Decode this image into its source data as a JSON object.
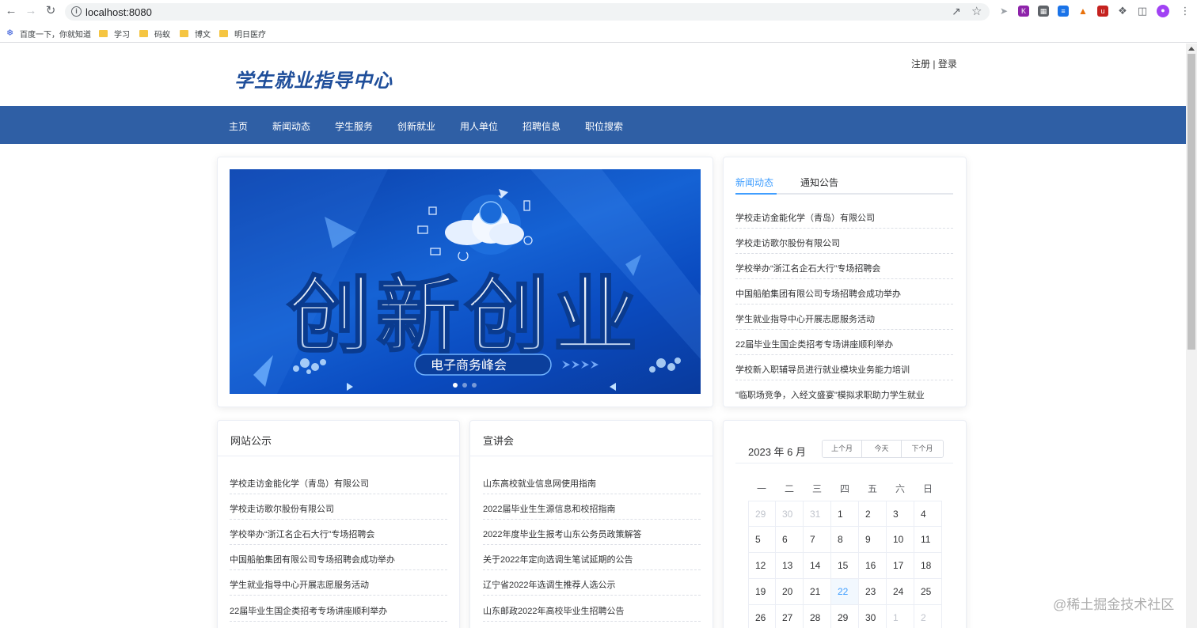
{
  "browser": {
    "url": "localhost:8080",
    "bookmarks": [
      "百度一下，你就知道",
      "学习",
      "码蚁",
      "博文",
      "明日医疗"
    ]
  },
  "header": {
    "logo_text": "学生就业指导中心",
    "register": "注册",
    "separator": "|",
    "login": "登录"
  },
  "nav": [
    "主页",
    "新闻动态",
    "学生服务",
    "创新就业",
    "用人单位",
    "招聘信息",
    "职位搜索"
  ],
  "banner": {
    "headline": "创新创业",
    "subtitle": "电子商务峰会",
    "active_slide": 0,
    "slide_count": 3
  },
  "news": {
    "tabs": [
      "新闻动态",
      "通知公告"
    ],
    "active_tab": 0,
    "items": [
      "学校走访金能化学（青岛）有限公司",
      "学校走访歌尔股份有限公司",
      "学校举办“浙江名企石大行”专场招聘会",
      "中国船舶集团有限公司专场招聘会成功举办",
      "学生就业指导中心开展志愿服务活动",
      "22届毕业生国企类招考专场讲座顺利举办",
      "学校新入职辅导员进行就业模块业务能力培训",
      "\"临职场竞争，入经文盛宴\"模拟求职助力学生就业"
    ]
  },
  "announcements": {
    "title": "网站公示",
    "items": [
      "学校走访金能化学（青岛）有限公司",
      "学校走访歌尔股份有限公司",
      "学校举办“浙江名企石大行”专场招聘会",
      "中国船舶集团有限公司专场招聘会成功举办",
      "学生就业指导中心开展志愿服务活动",
      "22届毕业生国企类招考专场讲座顺利举办"
    ]
  },
  "seminars": {
    "title": "宣讲会",
    "items": [
      "山东高校就业信息网使用指南",
      "2022届毕业生生源信息和校招指南",
      "2022年度毕业生报考山东公务员政策解答",
      "关于2022年定向选调生笔试延期的公告",
      "辽宁省2022年选调生推荐人选公示",
      "山东邮政2022年高校毕业生招聘公告"
    ]
  },
  "calendar": {
    "title": "2023 年 6 月",
    "buttons": [
      "上个月",
      "今天",
      "下个月"
    ],
    "weekdays": [
      "一",
      "二",
      "三",
      "四",
      "五",
      "六",
      "日"
    ],
    "weeks": [
      [
        "29",
        "30",
        "31",
        "1",
        "2",
        "3",
        "4"
      ],
      [
        "5",
        "6",
        "7",
        "8",
        "9",
        "10",
        "11"
      ],
      [
        "12",
        "13",
        "14",
        "15",
        "16",
        "17",
        "18"
      ],
      [
        "19",
        "20",
        "21",
        "22",
        "23",
        "24",
        "25"
      ],
      [
        "26",
        "27",
        "28",
        "29",
        "30",
        "1",
        "2"
      ]
    ],
    "today": "22"
  },
  "watermark": "@稀土掘金技术社区",
  "colors": {
    "nav_bg": "#2f5fa5",
    "accent": "#409eff",
    "logo": "#1f4e9a"
  }
}
